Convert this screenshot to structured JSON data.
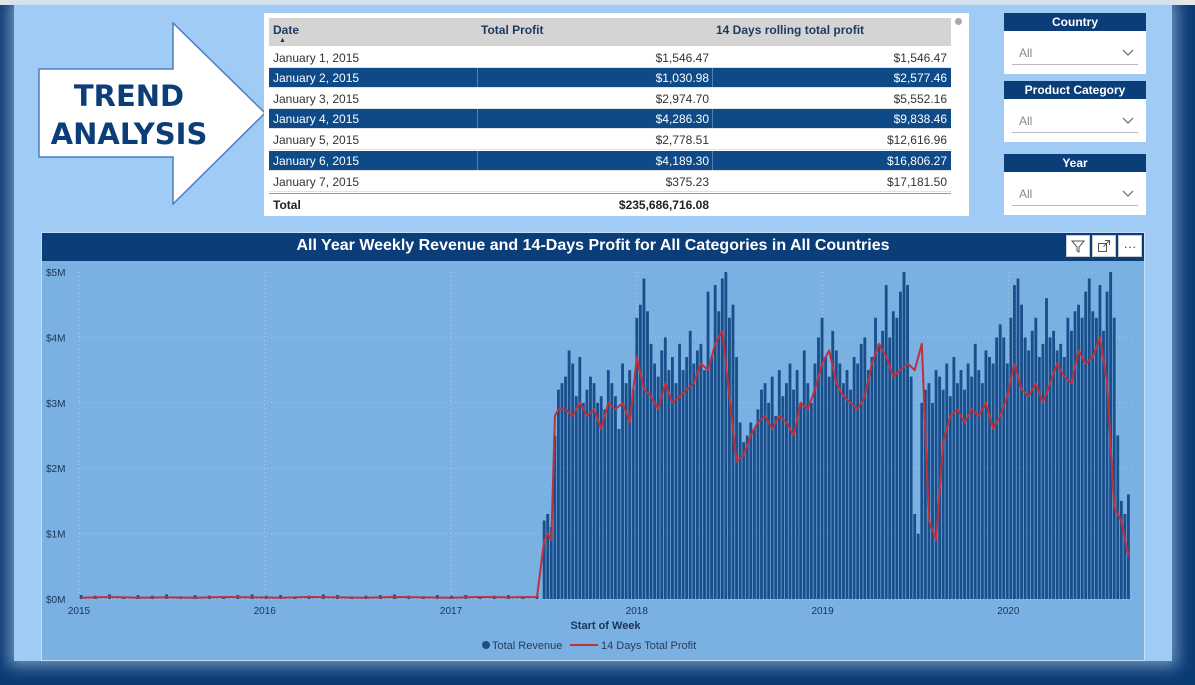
{
  "banner": {
    "line1": "TREND",
    "line2": "ANALYSIS"
  },
  "table": {
    "columns": [
      "Date",
      "Total Profit",
      "14 Days rolling total profit"
    ],
    "rows": [
      {
        "date": "January 1, 2015",
        "profit": "$1,546.47",
        "rolling": "$1,546.47"
      },
      {
        "date": "January 2, 2015",
        "profit": "$1,030.98",
        "rolling": "$2,577.46"
      },
      {
        "date": "January 3, 2015",
        "profit": "$2,974.70",
        "rolling": "$5,552.16"
      },
      {
        "date": "January 4, 2015",
        "profit": "$4,286.30",
        "rolling": "$9,838.46"
      },
      {
        "date": "January 5, 2015",
        "profit": "$2,778.51",
        "rolling": "$12,616.96"
      },
      {
        "date": "January 6, 2015",
        "profit": "$4,189.30",
        "rolling": "$16,806.27"
      },
      {
        "date": "January 7, 2015",
        "profit": "$375.23",
        "rolling": "$17,181.50"
      }
    ],
    "total_label": "Total",
    "total_value": "$235,686,716.08"
  },
  "slicers": [
    {
      "title": "Country",
      "value": "All"
    },
    {
      "title": "Product Category",
      "value": "All"
    },
    {
      "title": "Year",
      "value": "All"
    }
  ],
  "colors": {
    "bar": "#1a4f8b",
    "line": "#c0303b",
    "background": "#7ab0e2",
    "accent": "#0b3d78"
  },
  "chart_data": {
    "type": "bar",
    "title": "All Year Weekly Revenue and 14-Days Profit for All Categories in All Countries",
    "xlabel": "Start of Week",
    "ylabel": "",
    "x_ticks": [
      "2015",
      "2016",
      "2017",
      "2018",
      "2019",
      "2020"
    ],
    "y_ticks": [
      "$0M",
      "$1M",
      "$2M",
      "$3M",
      "$4M",
      "$5M"
    ],
    "ylim": [
      0,
      5000000
    ],
    "xlim": [
      "2015-01-01",
      "2020-08-31"
    ],
    "legend": [
      "Total Revenue",
      "14 Days Total Profit"
    ],
    "legend_position": "bottom",
    "grid": true,
    "series": [
      {
        "name": "Total Revenue",
        "type": "bar",
        "x": [
          "2015-01-05",
          "2015-02-02",
          "2015-03-02",
          "2015-03-30",
          "2015-04-27",
          "2015-05-25",
          "2015-06-22",
          "2015-07-20",
          "2015-08-17",
          "2015-09-14",
          "2015-10-12",
          "2015-11-09",
          "2015-12-07",
          "2016-01-04",
          "2016-02-01",
          "2016-02-29",
          "2016-03-28",
          "2016-04-25",
          "2016-05-23",
          "2016-06-20",
          "2016-07-18",
          "2016-08-15",
          "2016-09-12",
          "2016-10-10",
          "2016-11-07",
          "2016-12-05",
          "2017-01-02",
          "2017-01-30",
          "2017-02-27",
          "2017-03-27",
          "2017-04-24",
          "2017-05-22",
          "2017-06-19",
          "2017-07-03",
          "2017-07-10",
          "2017-07-17",
          "2017-07-24",
          "2017-07-31",
          "2017-08-07",
          "2017-08-14",
          "2017-08-21",
          "2017-08-28",
          "2017-09-04",
          "2017-09-11",
          "2017-09-18",
          "2017-09-25",
          "2017-10-02",
          "2017-10-09",
          "2017-10-16",
          "2017-10-23",
          "2017-10-30",
          "2017-11-06",
          "2017-11-13",
          "2017-11-20",
          "2017-11-27",
          "2017-12-04",
          "2017-12-11",
          "2017-12-18",
          "2017-12-25",
          "2018-01-01",
          "2018-01-08",
          "2018-01-15",
          "2018-01-22",
          "2018-01-29",
          "2018-02-05",
          "2018-02-12",
          "2018-02-19",
          "2018-02-26",
          "2018-03-05",
          "2018-03-12",
          "2018-03-19",
          "2018-03-26",
          "2018-04-02",
          "2018-04-09",
          "2018-04-16",
          "2018-04-23",
          "2018-04-30",
          "2018-05-07",
          "2018-05-14",
          "2018-05-21",
          "2018-05-28",
          "2018-06-04",
          "2018-06-11",
          "2018-06-18",
          "2018-06-25",
          "2018-07-02",
          "2018-07-09",
          "2018-07-16",
          "2018-07-23",
          "2018-07-30",
          "2018-08-06",
          "2018-08-13",
          "2018-08-20",
          "2018-08-27",
          "2018-09-03",
          "2018-09-10",
          "2018-09-17",
          "2018-09-24",
          "2018-10-01",
          "2018-10-08",
          "2018-10-15",
          "2018-10-22",
          "2018-10-29",
          "2018-11-05",
          "2018-11-12",
          "2018-11-19",
          "2018-11-26",
          "2018-12-03",
          "2018-12-10",
          "2018-12-17",
          "2018-12-24",
          "2018-12-31",
          "2019-01-07",
          "2019-01-14",
          "2019-01-21",
          "2019-01-28",
          "2019-02-04",
          "2019-02-11",
          "2019-02-18",
          "2019-02-25",
          "2019-03-04",
          "2019-03-11",
          "2019-03-18",
          "2019-03-25",
          "2019-04-01",
          "2019-04-08",
          "2019-04-15",
          "2019-04-22",
          "2019-04-29",
          "2019-05-06",
          "2019-05-13",
          "2019-05-20",
          "2019-05-27",
          "2019-06-03",
          "2019-06-10",
          "2019-06-17",
          "2019-06-24",
          "2019-07-01",
          "2019-07-08",
          "2019-07-15",
          "2019-07-22",
          "2019-07-29",
          "2019-08-05",
          "2019-08-12",
          "2019-08-19",
          "2019-08-26",
          "2019-09-02",
          "2019-09-09",
          "2019-09-16",
          "2019-09-23",
          "2019-09-30",
          "2019-10-07",
          "2019-10-14",
          "2019-10-21",
          "2019-10-28",
          "2019-11-04",
          "2019-11-11",
          "2019-11-18",
          "2019-11-25",
          "2019-12-02",
          "2019-12-09",
          "2019-12-16",
          "2019-12-23",
          "2019-12-30",
          "2020-01-06",
          "2020-01-13",
          "2020-01-20",
          "2020-01-27",
          "2020-02-03",
          "2020-02-10",
          "2020-02-17",
          "2020-02-24",
          "2020-03-02",
          "2020-03-09",
          "2020-03-16",
          "2020-03-23",
          "2020-03-30",
          "2020-04-06",
          "2020-04-13",
          "2020-04-20",
          "2020-04-27",
          "2020-05-04",
          "2020-05-11",
          "2020-05-18",
          "2020-05-25",
          "2020-06-01",
          "2020-06-08",
          "2020-06-15",
          "2020-06-22",
          "2020-06-29",
          "2020-07-06",
          "2020-07-13",
          "2020-07-20",
          "2020-07-27",
          "2020-08-03",
          "2020-08-10",
          "2020-08-17",
          "2020-08-24"
        ],
        "values": [
          60000,
          50000,
          70000,
          40000,
          60000,
          50000,
          70000,
          40000,
          60000,
          50000,
          40000,
          60000,
          70000,
          50000,
          60000,
          40000,
          50000,
          70000,
          60000,
          40000,
          50000,
          60000,
          70000,
          50000,
          40000,
          60000,
          50000,
          60000,
          40000,
          50000,
          60000,
          40000,
          50000,
          1200000,
          1300000,
          1100000,
          2500000,
          3200000,
          3300000,
          3400000,
          3800000,
          3600000,
          3100000,
          3700000,
          3000000,
          3200000,
          3400000,
          3300000,
          3000000,
          3100000,
          2900000,
          3500000,
          3300000,
          3100000,
          2600000,
          3600000,
          3300000,
          3500000,
          3200000,
          4300000,
          4500000,
          4900000,
          4400000,
          3900000,
          3600000,
          3400000,
          3800000,
          4000000,
          3500000,
          3700000,
          3300000,
          3900000,
          3500000,
          3700000,
          4100000,
          3600000,
          3800000,
          3900000,
          3500000,
          4700000,
          3700000,
          4800000,
          4400000,
          4900000,
          5000000,
          4300000,
          4500000,
          3700000,
          2700000,
          2400000,
          2500000,
          2700000,
          2600000,
          2900000,
          3200000,
          3300000,
          3000000,
          3400000,
          2800000,
          3500000,
          3100000,
          3300000,
          3600000,
          3200000,
          3500000,
          3000000,
          3800000,
          3300000,
          3000000,
          3600000,
          4000000,
          4300000,
          3700000,
          3400000,
          4100000,
          3800000,
          3600000,
          3300000,
          3500000,
          3200000,
          3700000,
          3600000,
          3900000,
          4000000,
          3500000,
          3700000,
          4300000,
          3900000,
          4100000,
          4800000,
          4000000,
          4400000,
          4300000,
          4700000,
          5000000,
          4800000,
          3400000,
          1300000,
          1000000,
          3000000,
          3200000,
          3300000,
          3000000,
          3500000,
          3400000,
          3200000,
          3600000,
          3100000,
          3700000,
          3300000,
          3500000,
          3200000,
          3600000,
          3400000,
          3900000,
          3500000,
          3300000,
          3800000,
          3700000,
          3600000,
          4000000,
          4200000,
          4000000,
          3600000,
          4300000,
          4800000,
          4900000,
          4500000,
          4000000,
          3800000,
          4100000,
          4300000,
          3700000,
          3900000,
          4600000,
          4000000,
          4100000,
          3800000,
          3900000,
          3700000,
          4300000,
          4100000,
          4400000,
          4500000,
          4300000,
          4700000,
          4900000,
          4400000,
          4300000,
          4800000,
          4100000,
          4700000,
          5000000,
          4300000,
          2500000,
          1500000,
          1300000,
          1600000
        ]
      },
      {
        "name": "14 Days Total Profit",
        "type": "line",
        "x": [
          "2015-01-05",
          "2015-03-02",
          "2015-04-27",
          "2015-06-22",
          "2015-08-17",
          "2015-10-12",
          "2015-12-07",
          "2016-02-01",
          "2016-03-28",
          "2016-05-23",
          "2016-07-18",
          "2016-09-12",
          "2016-11-07",
          "2017-01-02",
          "2017-02-27",
          "2017-04-24",
          "2017-06-19",
          "2017-07-03",
          "2017-07-10",
          "2017-07-17",
          "2017-07-24",
          "2017-07-31",
          "2017-08-14",
          "2017-08-28",
          "2017-09-11",
          "2017-09-25",
          "2017-10-09",
          "2017-10-23",
          "2017-11-06",
          "2017-11-20",
          "2017-12-04",
          "2017-12-18",
          "2018-01-01",
          "2018-01-15",
          "2018-01-29",
          "2018-02-12",
          "2018-02-26",
          "2018-03-12",
          "2018-03-26",
          "2018-04-09",
          "2018-04-23",
          "2018-05-07",
          "2018-05-21",
          "2018-06-04",
          "2018-06-18",
          "2018-07-02",
          "2018-07-16",
          "2018-07-30",
          "2018-08-13",
          "2018-08-27",
          "2018-09-10",
          "2018-09-24",
          "2018-10-08",
          "2018-10-22",
          "2018-11-05",
          "2018-11-19",
          "2018-12-03",
          "2018-12-17",
          "2018-12-31",
          "2019-01-14",
          "2019-01-28",
          "2019-02-11",
          "2019-02-25",
          "2019-03-11",
          "2019-03-25",
          "2019-04-08",
          "2019-04-22",
          "2019-05-06",
          "2019-05-20",
          "2019-06-03",
          "2019-06-17",
          "2019-07-01",
          "2019-07-15",
          "2019-07-29",
          "2019-08-12",
          "2019-08-26",
          "2019-09-09",
          "2019-09-23",
          "2019-10-07",
          "2019-10-21",
          "2019-11-04",
          "2019-11-18",
          "2019-12-02",
          "2019-12-16",
          "2019-12-30",
          "2020-01-13",
          "2020-01-27",
          "2020-02-10",
          "2020-02-24",
          "2020-03-09",
          "2020-03-23",
          "2020-04-06",
          "2020-04-20",
          "2020-05-04",
          "2020-05-18",
          "2020-06-01",
          "2020-06-15",
          "2020-06-29",
          "2020-07-13",
          "2020-07-27",
          "2020-08-10",
          "2020-08-24"
        ],
        "values": [
          20000,
          30000,
          20000,
          25000,
          20000,
          30000,
          25000,
          20000,
          30000,
          25000,
          20000,
          30000,
          25000,
          20000,
          30000,
          25000,
          30000,
          900000,
          1000000,
          900000,
          2800000,
          2900000,
          2900000,
          2800000,
          3000000,
          2800000,
          2900000,
          2600000,
          3000000,
          2900000,
          3000000,
          2700000,
          3700000,
          3200000,
          3100000,
          2900000,
          3300000,
          3000000,
          3100000,
          3200000,
          3300000,
          3600000,
          3500000,
          3900000,
          4100000,
          3100000,
          2100000,
          2200000,
          2500000,
          2700000,
          2800000,
          2600000,
          2800000,
          2700000,
          2500000,
          3000000,
          2900000,
          3200000,
          3600000,
          3800000,
          3300000,
          3100000,
          3000000,
          2900000,
          3100000,
          3600000,
          3900000,
          3700000,
          3400000,
          3500000,
          3600000,
          3500000,
          3900000,
          1200000,
          900000,
          2400000,
          2800000,
          2900000,
          2700000,
          2900000,
          2800000,
          3000000,
          2600000,
          2800000,
          3100000,
          3600000,
          3200000,
          3100000,
          3300000,
          3000000,
          3300000,
          3600000,
          3400000,
          3300000,
          3800000,
          3600000,
          3700000,
          4000000,
          3300000,
          1400000,
          1200000,
          650000
        ]
      }
    ]
  }
}
